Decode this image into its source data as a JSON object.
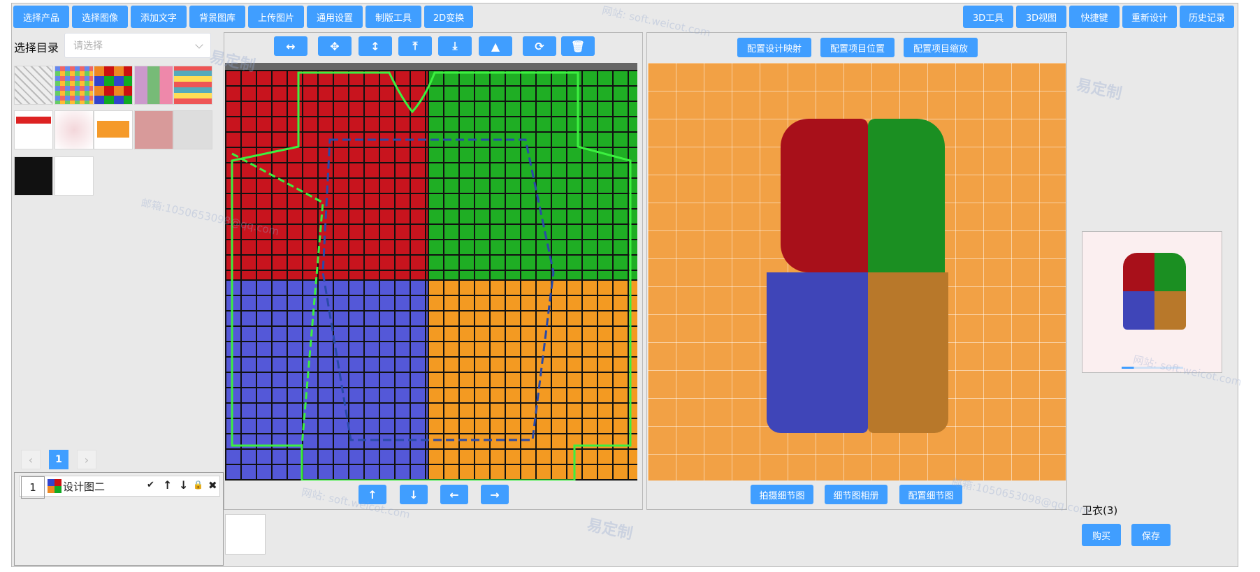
{
  "toolbar": {
    "left": [
      "选择产品",
      "选择图像",
      "添加文字",
      "背景图库",
      "上传图片",
      "通用设置",
      "制版工具",
      "2D变换"
    ],
    "right": [
      "3D工具",
      "3D视图",
      "快捷键",
      "重新设计",
      "历史记录"
    ]
  },
  "catalog": {
    "label": "选择目录",
    "placeholder": "请选择"
  },
  "canvas_tools": [
    "↔",
    "✥",
    "↕",
    "⤒",
    "⤓",
    "▲",
    "⟳",
    "🗑"
  ],
  "canvas_nav": [
    "↑",
    "↓",
    "←",
    "→"
  ],
  "view3d": {
    "top_buttons": [
      "配置设计映射",
      "配置项目位置",
      "配置项目缩放"
    ],
    "bottom_buttons": [
      "拍摄细节图",
      "细节图相册",
      "配置细节图"
    ]
  },
  "pagination": {
    "prev": "‹",
    "current": "1",
    "next": "›"
  },
  "layers": [
    {
      "index": "1",
      "name": "设计图二"
    }
  ],
  "layer_actions": [
    "✔",
    "↑",
    "↓",
    "🔒",
    "✖"
  ],
  "product": {
    "name": "卫衣(3)",
    "buy_label": "购买",
    "save_label": "保存"
  },
  "watermark": {
    "brand": "易定制",
    "site": "网站: soft.weicot.com",
    "mail": "邮箱:1050653098@qq.com"
  },
  "colors": {
    "accent": "#409eff",
    "red": "#c8141e",
    "green": "#1fae24",
    "blue": "#5458d8",
    "orange": "#f39a22"
  }
}
